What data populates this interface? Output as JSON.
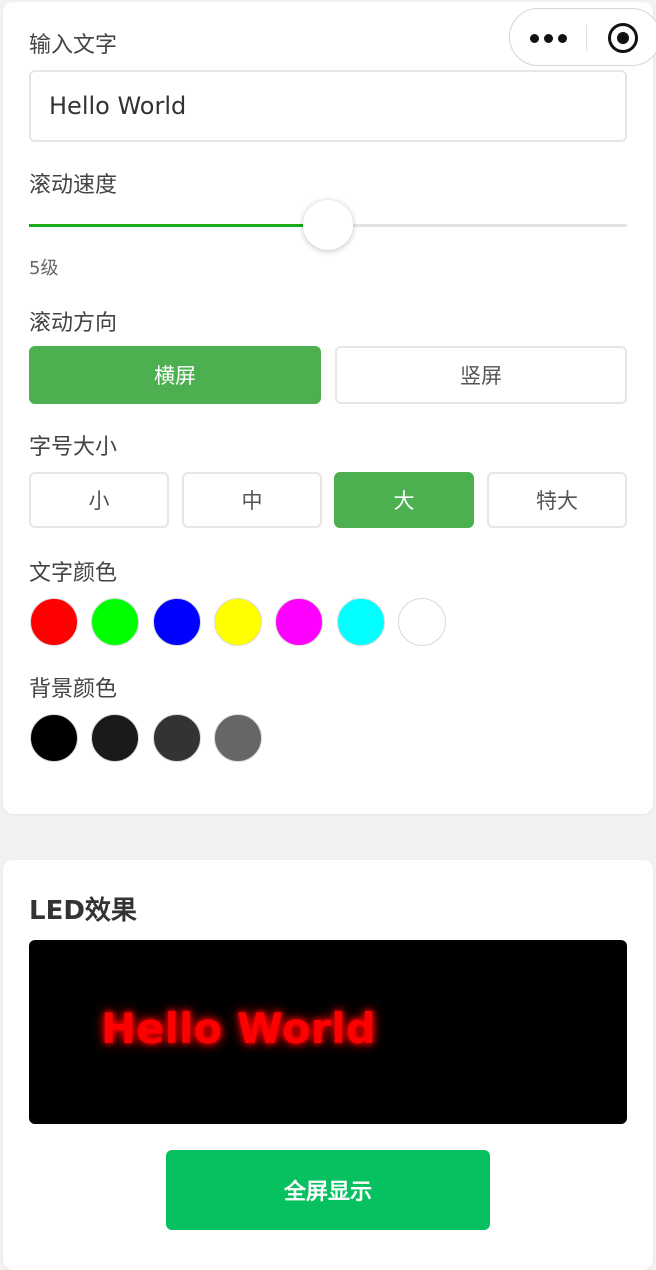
{
  "capsule": {
    "menu_icon": "more-dots-icon",
    "close_icon": "target-circle-icon"
  },
  "text_input": {
    "label": "输入文字",
    "value": "Hello World"
  },
  "speed": {
    "label": "滚动速度",
    "value_label": "5级",
    "level": 5,
    "max_level": 10,
    "fill_fraction": 0.5
  },
  "direction": {
    "label": "滚动方向",
    "options": [
      "横屏",
      "竖屏"
    ],
    "selected": 0
  },
  "font_size": {
    "label": "字号大小",
    "options": [
      "小",
      "中",
      "大",
      "特大"
    ],
    "selected": 2
  },
  "text_color": {
    "label": "文字颜色",
    "swatches": [
      "#ff0000",
      "#00ff00",
      "#0000ff",
      "#ffff00",
      "#ff00ff",
      "#00ffff",
      "#ffffff"
    ]
  },
  "bg_color": {
    "label": "背景颜色",
    "swatches": [
      "#000000",
      "#1a1a1a",
      "#333333",
      "#666666"
    ]
  },
  "preview": {
    "title": "LED效果",
    "led_text": "Hello World",
    "led_color": "#ff0000",
    "led_bg": "#000000",
    "fullscreen_label": "全屏显示"
  },
  "colors": {
    "accent": "#4caf50",
    "slider": "#1aad19",
    "primary_button": "#07c160"
  }
}
